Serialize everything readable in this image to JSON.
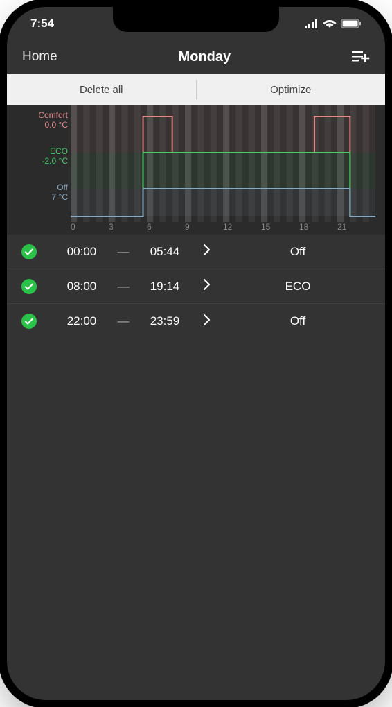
{
  "status_bar": {
    "time": "7:54"
  },
  "nav": {
    "back": "Home",
    "title": "Monday"
  },
  "actions": {
    "delete": "Delete all",
    "optimize": "Optimize"
  },
  "chart_data": {
    "type": "line",
    "levels": [
      {
        "name": "Comfort",
        "temp": "0.0 °C",
        "y": 0,
        "color": "#e08b8b"
      },
      {
        "name": "ECO",
        "temp": "-2.0 °C",
        "y": 1,
        "color": "#4bc96b"
      },
      {
        "name": "Off",
        "temp": "7 °C",
        "y": 2,
        "color": "#8aa8c0"
      }
    ],
    "tracks": [
      {
        "color": "#e08b8b",
        "points": [
          [
            0,
            2.5
          ],
          [
            5.7,
            2.5
          ],
          [
            5.7,
            0
          ],
          [
            8,
            0
          ],
          [
            8,
            1
          ],
          [
            19.2,
            1
          ],
          [
            19.2,
            0
          ],
          [
            22,
            0
          ],
          [
            22,
            2.5
          ],
          [
            24,
            2.5
          ]
        ]
      },
      {
        "color": "#4bc96b",
        "points": [
          [
            0,
            2.5
          ],
          [
            5.7,
            2.5
          ],
          [
            5.7,
            1
          ],
          [
            8,
            1
          ],
          [
            8,
            1
          ],
          [
            19.2,
            1
          ],
          [
            19.2,
            1
          ],
          [
            22,
            1
          ],
          [
            22,
            2.5
          ],
          [
            24,
            2.5
          ]
        ]
      },
      {
        "color": "#8aa8c0",
        "points": [
          [
            0,
            2.5
          ],
          [
            5.7,
            2.5
          ],
          [
            5.7,
            2
          ],
          [
            8,
            2
          ],
          [
            8,
            2
          ],
          [
            19.2,
            2
          ],
          [
            19.2,
            2
          ],
          [
            22,
            2
          ],
          [
            22,
            2.5
          ],
          [
            24,
            2.5
          ]
        ]
      }
    ],
    "xticks": [
      "0",
      "3",
      "6",
      "9",
      "12",
      "15",
      "18",
      "21"
    ],
    "xlim": [
      0,
      24
    ],
    "ylim": [
      0,
      3
    ]
  },
  "schedule": [
    {
      "from": "00:00",
      "to": "05:44",
      "mode": "Off"
    },
    {
      "from": "08:00",
      "to": "19:14",
      "mode": "ECO"
    },
    {
      "from": "22:00",
      "to": "23:59",
      "mode": "Off"
    }
  ],
  "dash": "—"
}
